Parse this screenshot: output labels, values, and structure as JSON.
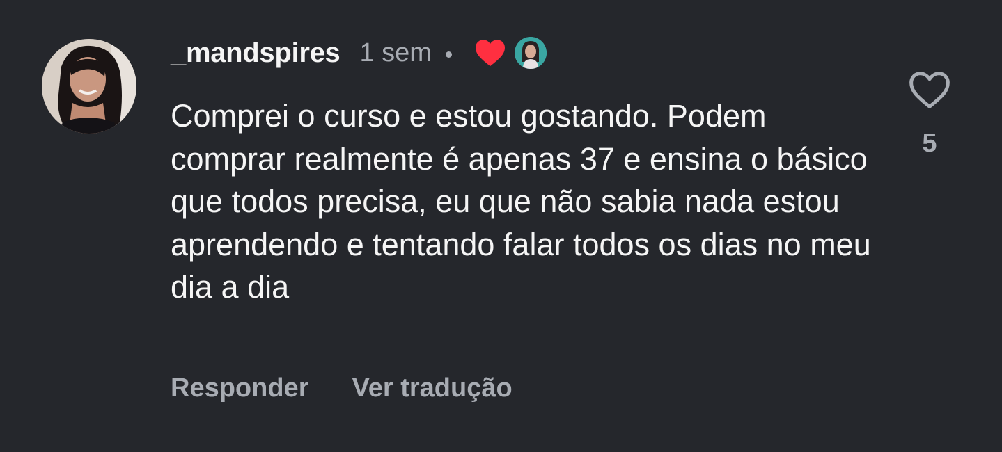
{
  "comment": {
    "username": "_mandspires",
    "time": "1 sem",
    "text": "Comprei o curso e estou gostando. Podem comprar realmente é apenas 37 e ensina o básico que todos precisa, eu que não sabia nada estou aprendendo e tentando falar todos os dias no meu dia a dia",
    "like_count": "5"
  },
  "actions": {
    "reply_label": "Responder",
    "translate_label": "Ver tradução"
  },
  "icons": {
    "creator_like": "heart-filled-icon",
    "like": "heart-outline-icon"
  },
  "colors": {
    "background": "#25272c",
    "primary_text": "#f5f5f5",
    "secondary_text": "#a8acb3",
    "heart_red": "#ff2f40"
  }
}
